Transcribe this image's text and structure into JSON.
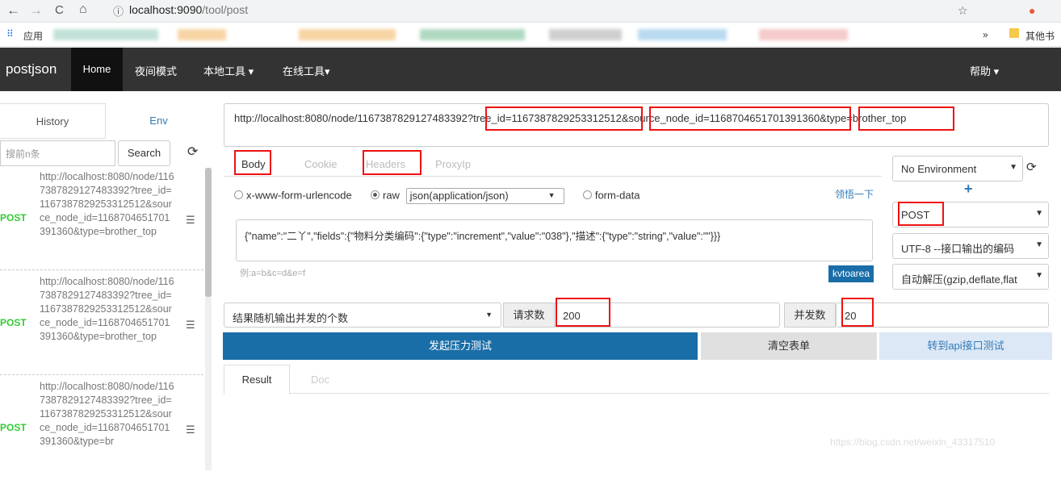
{
  "browser": {
    "url_host": "localhost:9090",
    "url_path": "/tool/post",
    "bookmarks_apps": "应用",
    "bookmarks_more": "»",
    "bookmarks_other": "其他书"
  },
  "navbar": {
    "brand": "postjson",
    "items": [
      "Home",
      "夜间模式",
      "本地工具 ▾",
      "在线工具▾"
    ],
    "help": "帮助 ▾"
  },
  "sidebar": {
    "tabs": [
      "History",
      "Env"
    ],
    "search_placeholder": "搜前n条",
    "search_label": "Search",
    "history": [
      {
        "method": "POST",
        "url": "http://localhost:8080/node/1167387829127483392?tree_id=1167387829253312512&source_node_id=1168704651701391360&type=brother_top"
      },
      {
        "method": "POST",
        "url": "http://localhost:8080/node/1167387829127483392?tree_id=1167387829253312512&source_node_id=1168704651701391360&type=brother_top"
      },
      {
        "method": "POST",
        "url": "http://localhost:8080/node/1167387829127483392?tree_id=1167387829253312512&source_node_id=1168704651701391360&type=br"
      }
    ]
  },
  "request": {
    "url": "http://localhost:8080/node/1167387829127483392?tree_id=1167387829253312512&source_node_id=1168704651701391360&type=brother_top",
    "tabs": [
      "Body",
      "Cookie",
      "Headers",
      "ProxyIp"
    ],
    "body_types": [
      "x-www-form-urlencode",
      "raw",
      "form-data"
    ],
    "raw_type": "json(application/json)",
    "hint_link": "领悟一下",
    "body": "{\"name\":\"二丫\",\"fields\":{\"物料分类编码\":{\"type\":\"increment\",\"value\":\"038\"},\"描述\":{\"type\":\"string\",\"value\":\"\"}}}",
    "example": "例:a=b&c=d&e=f",
    "kv_button": "kvtoarea"
  },
  "right_panel": {
    "environment": "No Environment",
    "method": "POST",
    "encoding": "UTF-8 --接口输出的编码",
    "decompress": "自动解压(gzip,deflate,flat"
  },
  "load_test": {
    "mode": "结果随机输出并发的个数",
    "request_count_label": "请求数",
    "request_count": "200",
    "concurrency_label": "并发数",
    "concurrency": "20",
    "start_button": "发起压力测试",
    "clear_button": "清空表单",
    "api_button": "转到api接口测试"
  },
  "result": {
    "tabs": [
      "Result",
      "Doc"
    ]
  },
  "watermark": "https://blog.csdn.net/weixin_43317510"
}
